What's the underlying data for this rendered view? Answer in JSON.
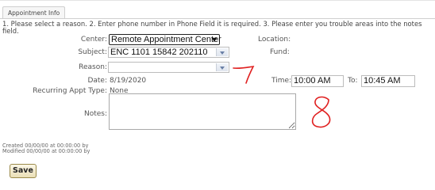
{
  "tab": {
    "label": "Appointment Info"
  },
  "instructions": "1. Please select a reason. 2. Enter phone number in Phone Field it is required. 3. Please enter you trouble areas into the notes field.",
  "form": {
    "center": {
      "label": "Center:",
      "value": "Remote Appointment Center"
    },
    "location": {
      "label": "Location:",
      "value": ""
    },
    "subject": {
      "label": "Subject:",
      "value": "ENC 1101 15842 202110"
    },
    "fund": {
      "label": "Fund:",
      "value": ""
    },
    "reason": {
      "label": "Reason:",
      "value": ""
    },
    "date": {
      "label": "Date:",
      "value": "8/19/2020"
    },
    "time": {
      "label": "Time:",
      "value": "10:00 AM"
    },
    "to": {
      "label": "To:",
      "value": "10:45 AM"
    },
    "recurring": {
      "label": "Recurring Appt Type:",
      "value": "None"
    },
    "notes": {
      "label": "Notes:",
      "value": ""
    }
  },
  "meta": {
    "created": "Created 00/00/00 at 00:00:00 by",
    "modified": "Modified 00/00/00 at 00:00:00 by"
  },
  "buttons": {
    "save_label": "Save"
  },
  "annotations": {
    "reason_mark": "7",
    "notes_mark": "8",
    "color": "#e02020"
  }
}
